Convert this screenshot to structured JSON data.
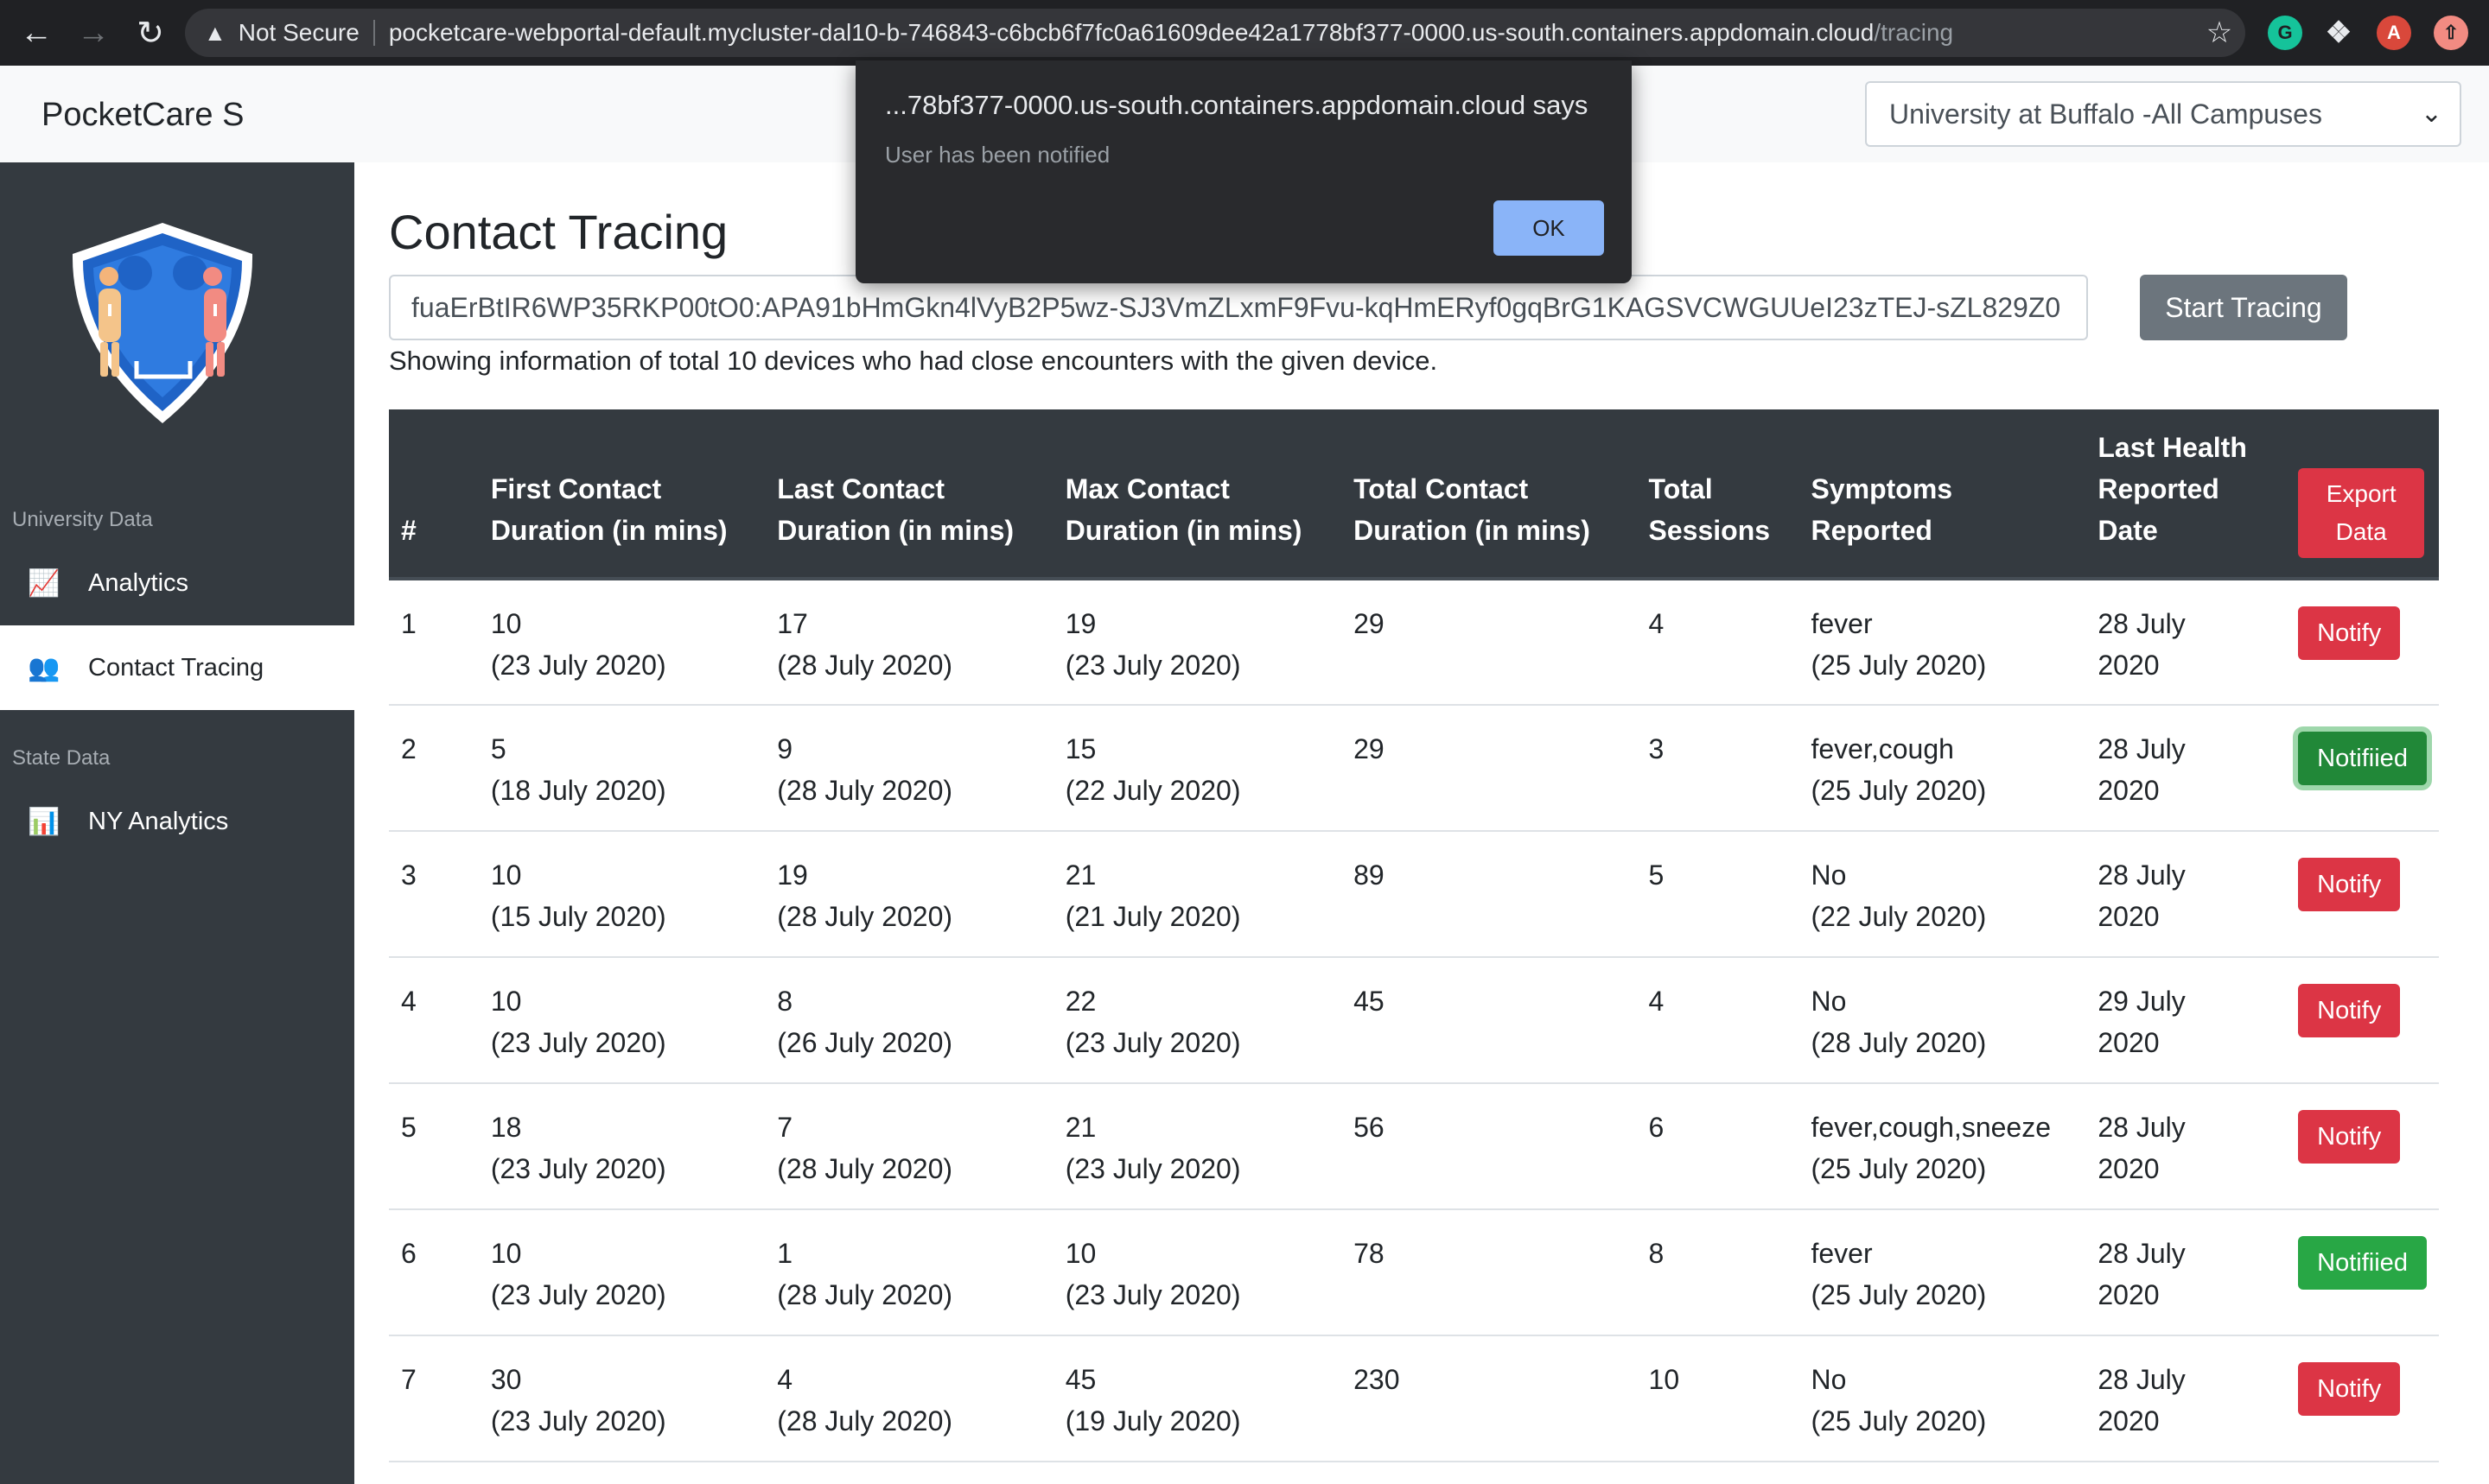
{
  "browser": {
    "security_label": "Not Secure",
    "url_host": "pocketcare-webportal-default.mycluster-dal10-b-746843-c6bcb6f7fc0a61609dee42a1778bf377-0000.us-south.containers.appdomain.cloud",
    "url_path": "/tracing",
    "profile_initial": "A",
    "grammarly_initial": "G"
  },
  "navbar": {
    "brand": "PocketCare S",
    "campus_selected": "University at Buffalo -All Campuses"
  },
  "sidebar": {
    "university_heading": "University Data",
    "state_heading": "State Data",
    "items": [
      {
        "label": "Analytics",
        "icon": "line-chart-icon"
      },
      {
        "label": "Contact Tracing",
        "icon": "users-icon"
      },
      {
        "label": "NY Analytics",
        "icon": "bar-chart-icon"
      }
    ]
  },
  "main": {
    "title": "Contact Tracing",
    "device_id": "fuaErBtIR6WP35RKP00tO0:APA91bHmGkn4lVyB2P5wz-SJ3VmZLxmF9Fvu-kqHmERyf0gqBrG1KAGSVCWGUUeI23zTEJ-sZL829Z0",
    "start_button": "Start Tracing",
    "summary": "Showing information of total 10 devices who had close encounters with the given device."
  },
  "table": {
    "headers": {
      "index": "#",
      "first": [
        "First Contact",
        "Duration (in mins)"
      ],
      "last": [
        "Last Contact",
        "Duration (in mins)"
      ],
      "max": [
        "Max Contact",
        "Duration (in mins)"
      ],
      "total": [
        "Total Contact",
        "Duration (in mins)"
      ],
      "sessions": [
        "Total",
        "Sessions"
      ],
      "symptoms": [
        "Symptoms",
        "Reported"
      ],
      "health": [
        "Last Health",
        "Reported",
        "Date"
      ],
      "export": [
        "Export",
        "Data"
      ]
    },
    "rows": [
      {
        "n": "1",
        "first": "10",
        "first_date": "(23 July 2020)",
        "last": "17",
        "last_date": "(28 July 2020)",
        "max": "19",
        "max_date": "(23 July 2020)",
        "total": "29",
        "sessions": "4",
        "symptoms": "fever",
        "symptoms_date": "(25 July 2020)",
        "health_a": "28 July",
        "health_b": "2020",
        "action": "Notify",
        "status": "notify"
      },
      {
        "n": "2",
        "first": "5",
        "first_date": "(18 July 2020)",
        "last": "9",
        "last_date": "(28 July 2020)",
        "max": "15",
        "max_date": "(22 July 2020)",
        "total": "29",
        "sessions": "3",
        "symptoms": "fever,cough",
        "symptoms_date": "(25 July 2020)",
        "health_a": "28 July",
        "health_b": "2020",
        "action": "Notifiied",
        "status": "notified-focus"
      },
      {
        "n": "3",
        "first": "10",
        "first_date": "(15 July 2020)",
        "last": "19",
        "last_date": "(28 July 2020)",
        "max": "21",
        "max_date": "(21 July 2020)",
        "total": "89",
        "sessions": "5",
        "symptoms": "No",
        "symptoms_date": "(22 July 2020)",
        "health_a": "28 July",
        "health_b": "2020",
        "action": "Notify",
        "status": "notify"
      },
      {
        "n": "4",
        "first": "10",
        "first_date": "(23 July 2020)",
        "last": "8",
        "last_date": "(26 July 2020)",
        "max": "22",
        "max_date": "(23 July 2020)",
        "total": "45",
        "sessions": "4",
        "symptoms": "No",
        "symptoms_date": "(28 July 2020)",
        "health_a": "29 July",
        "health_b": "2020",
        "action": "Notify",
        "status": "notify"
      },
      {
        "n": "5",
        "first": "18",
        "first_date": "(23 July 2020)",
        "last": "7",
        "last_date": "(28 July 2020)",
        "max": "21",
        "max_date": "(23 July 2020)",
        "total": "56",
        "sessions": "6",
        "symptoms": "fever,cough,sneeze",
        "symptoms_date": "(25 July 2020)",
        "health_a": "28 July",
        "health_b": "2020",
        "action": "Notify",
        "status": "notify"
      },
      {
        "n": "6",
        "first": "10",
        "first_date": "(23 July 2020)",
        "last": "1",
        "last_date": "(28 July 2020)",
        "max": "10",
        "max_date": "(23 July 2020)",
        "total": "78",
        "sessions": "8",
        "symptoms": "fever",
        "symptoms_date": "(25 July 2020)",
        "health_a": "28 July",
        "health_b": "2020",
        "action": "Notifiied",
        "status": "notified"
      },
      {
        "n": "7",
        "first": "30",
        "first_date": "(23 July 2020)",
        "last": "4",
        "last_date": "(28 July 2020)",
        "max": "45",
        "max_date": "(19 July 2020)",
        "total": "230",
        "sessions": "10",
        "symptoms": "No",
        "symptoms_date": "(25 July 2020)",
        "health_a": "28 July",
        "health_b": "2020",
        "action": "Notify",
        "status": "notify"
      }
    ]
  },
  "alert": {
    "title": "...78bf377-0000.us-south.containers.appdomain.cloud says",
    "message": "User has been notified",
    "ok": "OK"
  },
  "colors": {
    "sidebar_bg": "#343a40",
    "notify": "#dc3545",
    "notified": "#28a745",
    "start_button": "#6c757d",
    "alert_ok": "#8ab4f8"
  }
}
